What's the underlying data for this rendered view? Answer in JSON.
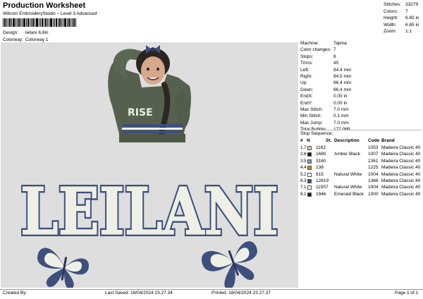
{
  "header": {
    "title": "Production Worksheet",
    "subtitle": "Wilcom EmbroideryStudio – Level 3 Advanced",
    "design_label": "Design:",
    "design_value": "leilani 6,8in",
    "colorway_label": "Colorway:",
    "colorway_value": "Colorway 1"
  },
  "stats": [
    {
      "label": "Stitches:",
      "value": "33279"
    },
    {
      "label": "Colors:",
      "value": "7"
    },
    {
      "label": "Height:",
      "value": "6.80 in"
    },
    {
      "label": "Width:",
      "value": "6.65 in"
    },
    {
      "label": "Zoom:",
      "value": "1:1"
    }
  ],
  "machine": [
    {
      "label": "Machine:",
      "value": "Tajima"
    },
    {
      "label": "Color changes:",
      "value": "7"
    },
    {
      "label": "Stops:",
      "value": "8"
    },
    {
      "label": "Trims:",
      "value": "45"
    },
    {
      "label": "Left:",
      "value": "84.4 mm"
    },
    {
      "label": "Right:",
      "value": "84.5 mm"
    },
    {
      "label": "Up:",
      "value": "86.4 mm"
    },
    {
      "label": "Down:",
      "value": "86.4 mm"
    },
    {
      "label": "EndX:",
      "value": "0.00 in"
    },
    {
      "label": "EndY:",
      "value": "0.00 in"
    },
    {
      "label": "Max Stitch:",
      "value": "7.0 mm"
    },
    {
      "label": "Min Stitch:",
      "value": "0.1 mm"
    },
    {
      "label": "Max Jump:",
      "value": "7.0 mm"
    },
    {
      "label": "Total Bobbin:",
      "value": "172.06ft"
    }
  ],
  "stop_sequence": {
    "title": "Stop Sequence:",
    "headers": [
      "#",
      "N",
      "St.",
      "Description",
      "Code",
      "Brand"
    ],
    "rows": [
      {
        "num": "1.",
        "n": "7",
        "color": "#f2c3a8",
        "st": "1162",
        "desc": "",
        "code": "1053",
        "brand": "Madeira Classic 40"
      },
      {
        "num": "2.",
        "n": "6",
        "color": "#1d1a1a",
        "st": "1680",
        "desc": "Amber Black",
        "code": "1007",
        "brand": "Madeira Classic 40"
      },
      {
        "num": "3.",
        "n": "5",
        "color": "#8a9aae",
        "st": "3160",
        "desc": "",
        "code": "1361",
        "brand": "Madeira Classic 40"
      },
      {
        "num": "4.",
        "n": "4",
        "color": "#c8891c",
        "st": "138",
        "desc": "",
        "code": "1225",
        "brand": "Madeira Classic 40"
      },
      {
        "num": "5.",
        "n": "2",
        "color": "#f6f6f0",
        "st": "815",
        "desc": "Natural White",
        "code": "1004",
        "brand": "Madeira Classic 40"
      },
      {
        "num": "6.",
        "n": "3",
        "color": "#3b4f7d",
        "st": "12819",
        "desc": "",
        "code": "1366",
        "brand": "Madeira Classic 40"
      },
      {
        "num": "7.",
        "n": "1",
        "color": "#f6f6f0",
        "st": "11557",
        "desc": "Natural White",
        "code": "1004",
        "brand": "Madeira Classic 40"
      },
      {
        "num": "8.",
        "n": "1",
        "color": "#0d2a1e",
        "st": "1946",
        "desc": "Emerald Black",
        "code": "1000",
        "brand": "Madeira Classic 40"
      }
    ]
  },
  "design": {
    "word": "LEILANI",
    "shirt_text": "RISE",
    "background": "#dedede",
    "navy": "#3e4f7e",
    "cream": "#eef0e6",
    "sweater": "#56604f"
  },
  "footer": {
    "created_by": "Created By:",
    "last_saved": "Last Saved: 18/04/2024 23.27.34",
    "printed": "Printed: 18/04/2024 23.27.37",
    "page": "Page 1 of 1"
  }
}
